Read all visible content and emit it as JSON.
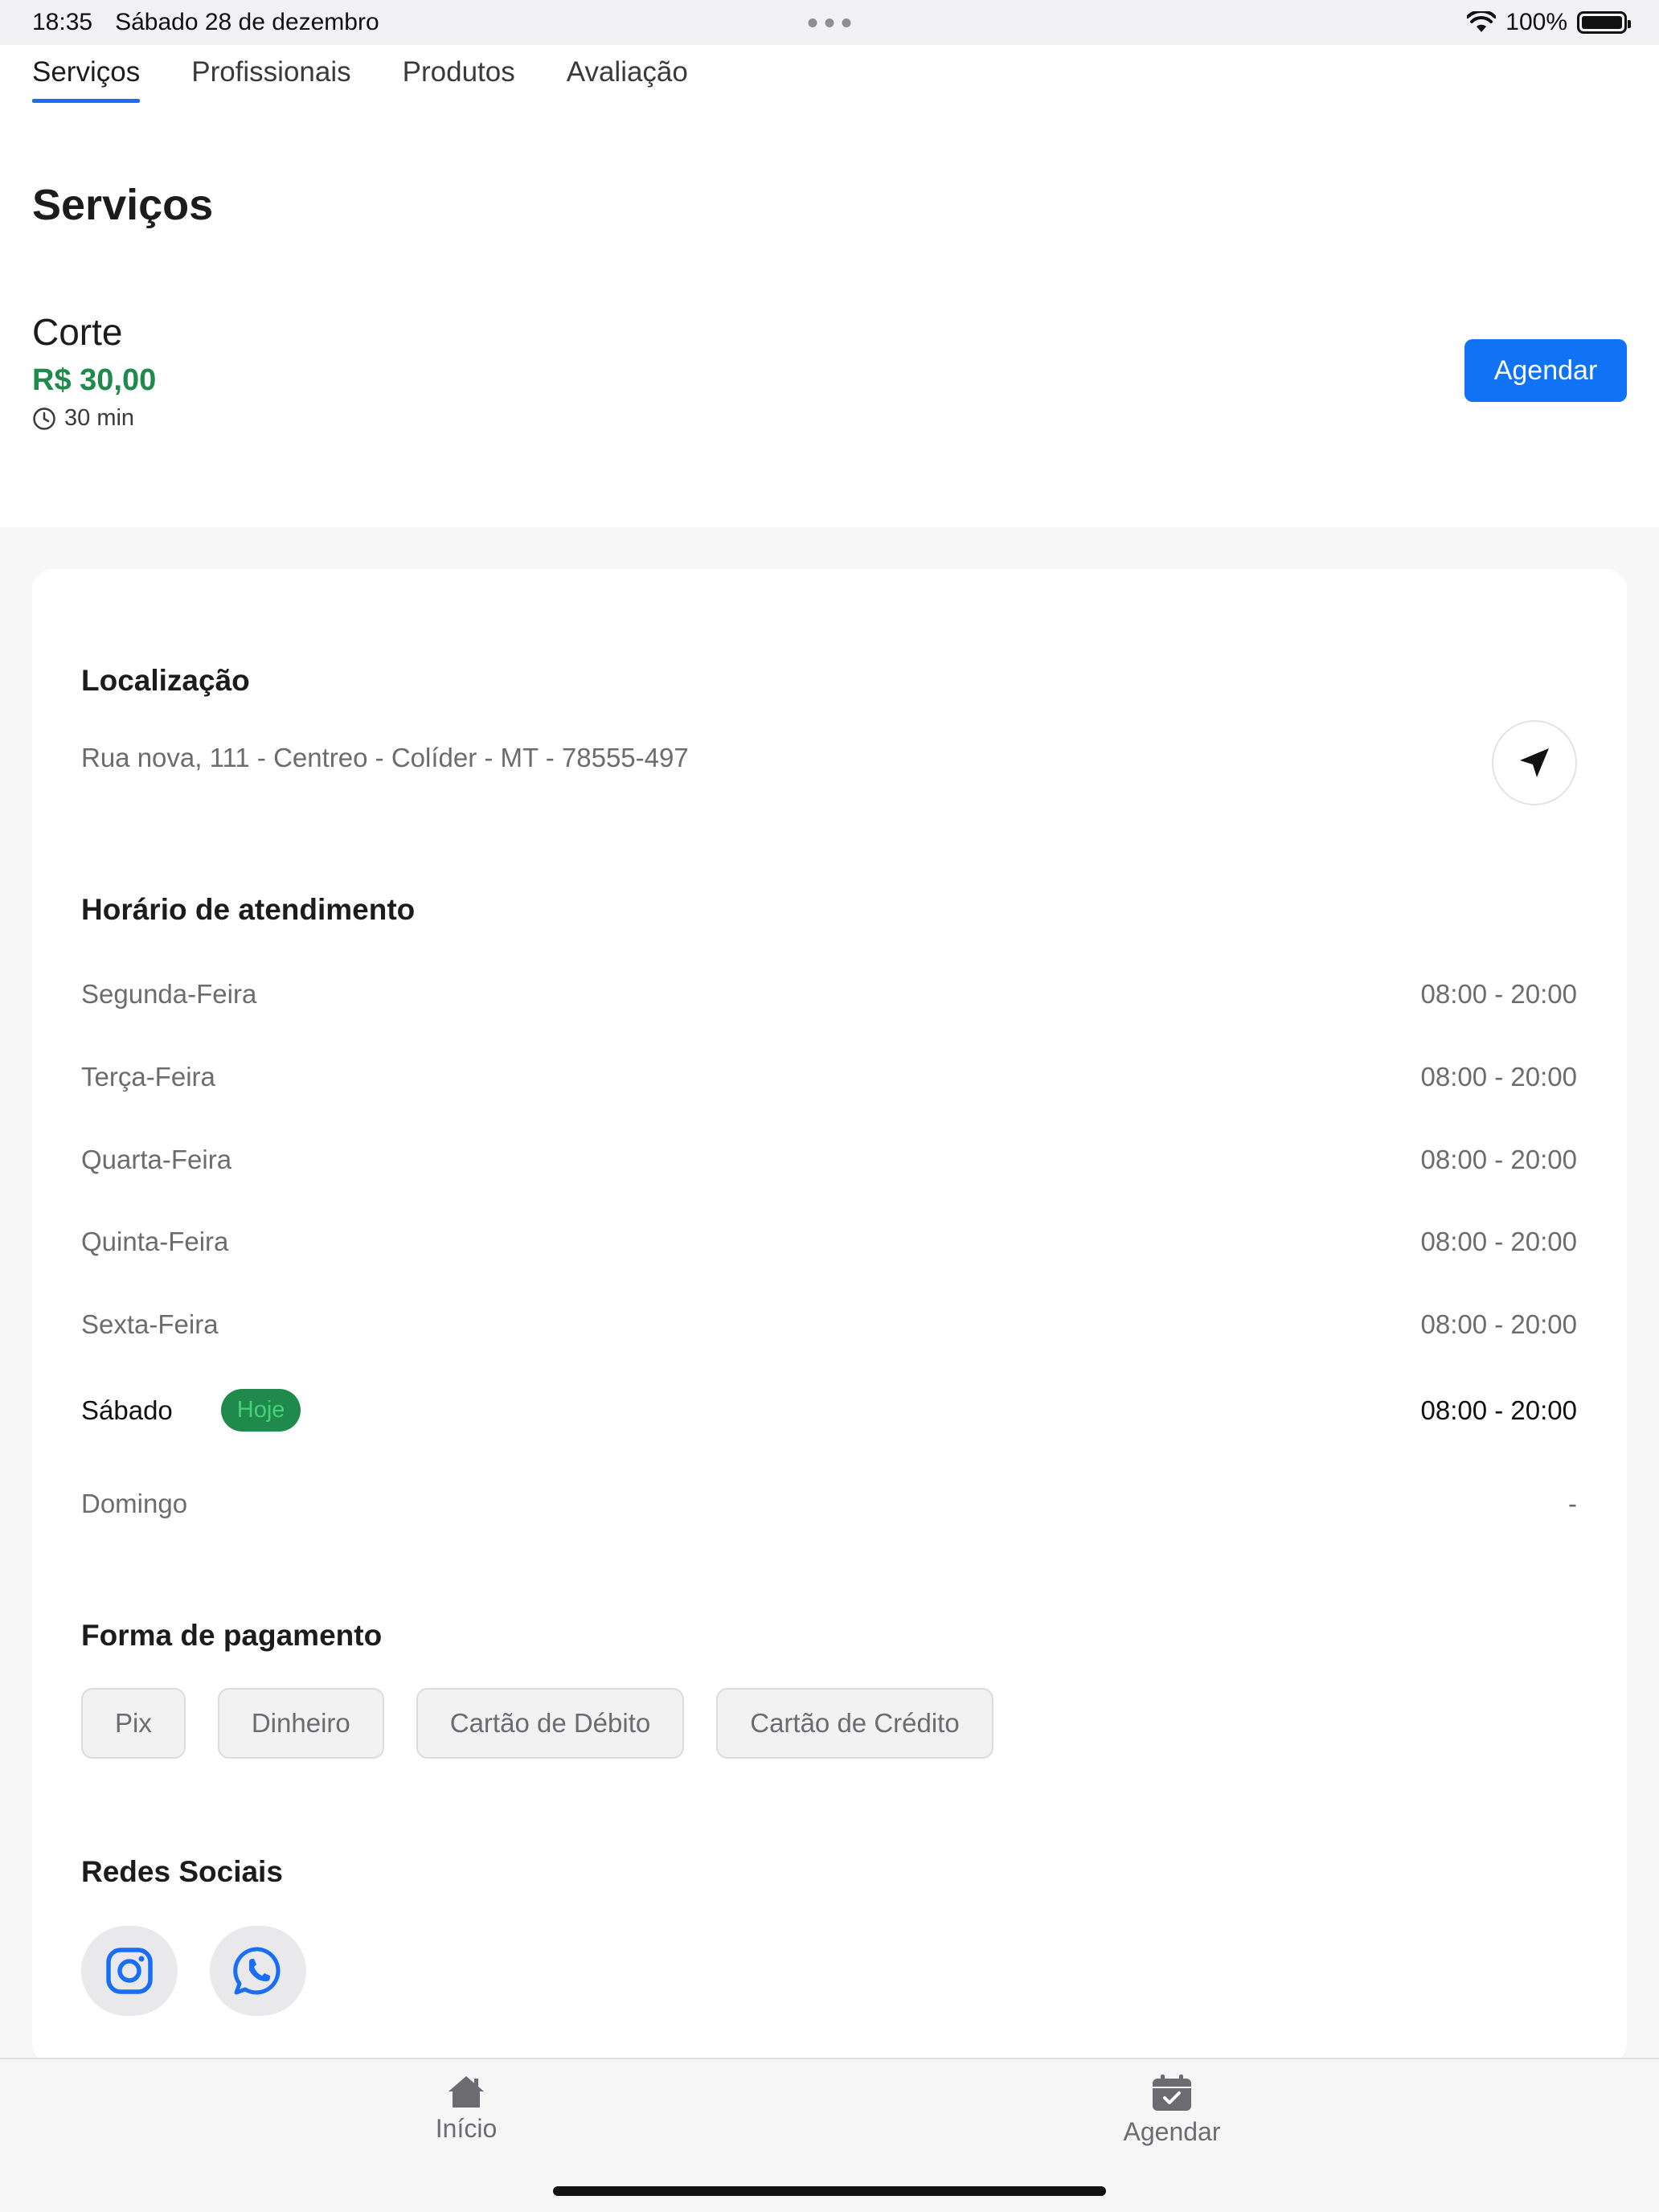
{
  "status_bar": {
    "time": "18:35",
    "date": "Sábado 28 de dezembro",
    "battery": "100%"
  },
  "tabs": [
    {
      "label": "Serviços",
      "active": true
    },
    {
      "label": "Profissionais",
      "active": false
    },
    {
      "label": "Produtos",
      "active": false
    },
    {
      "label": "Avaliação",
      "active": false
    }
  ],
  "services": {
    "title": "Serviços",
    "item": {
      "name": "Corte",
      "price": "R$ 30,00",
      "duration": "30 min",
      "button_label": "Agendar"
    }
  },
  "location": {
    "heading": "Localização",
    "address": "Rua nova, 111 - Centreo - Colíder - MT - 78555-497"
  },
  "hours": {
    "heading": "Horário de atendimento",
    "today_badge": "Hoje",
    "rows": [
      {
        "day": "Segunda-Feira",
        "time": "08:00 - 20:00"
      },
      {
        "day": "Terça-Feira",
        "time": "08:00 - 20:00"
      },
      {
        "day": "Quarta-Feira",
        "time": "08:00 - 20:00"
      },
      {
        "day": "Quinta-Feira",
        "time": "08:00 - 20:00"
      },
      {
        "day": "Sexta-Feira",
        "time": "08:00 - 20:00"
      },
      {
        "day": "Sábado",
        "time": "08:00 - 20:00"
      },
      {
        "day": "Domingo",
        "time": "-"
      }
    ]
  },
  "payment": {
    "heading": "Forma de pagamento",
    "methods": [
      "Pix",
      "Dinheiro",
      "Cartão de Débito",
      "Cartão de Crédito"
    ]
  },
  "social": {
    "heading": "Redes Sociais",
    "icons": [
      "instagram-icon",
      "whatsapp-icon"
    ]
  },
  "tabbar": {
    "home_label": "Início",
    "schedule_label": "Agendar"
  },
  "colors": {
    "accent": "#1072f5",
    "price": "#1f8a4c",
    "today_badge": "#1f8a4c"
  }
}
